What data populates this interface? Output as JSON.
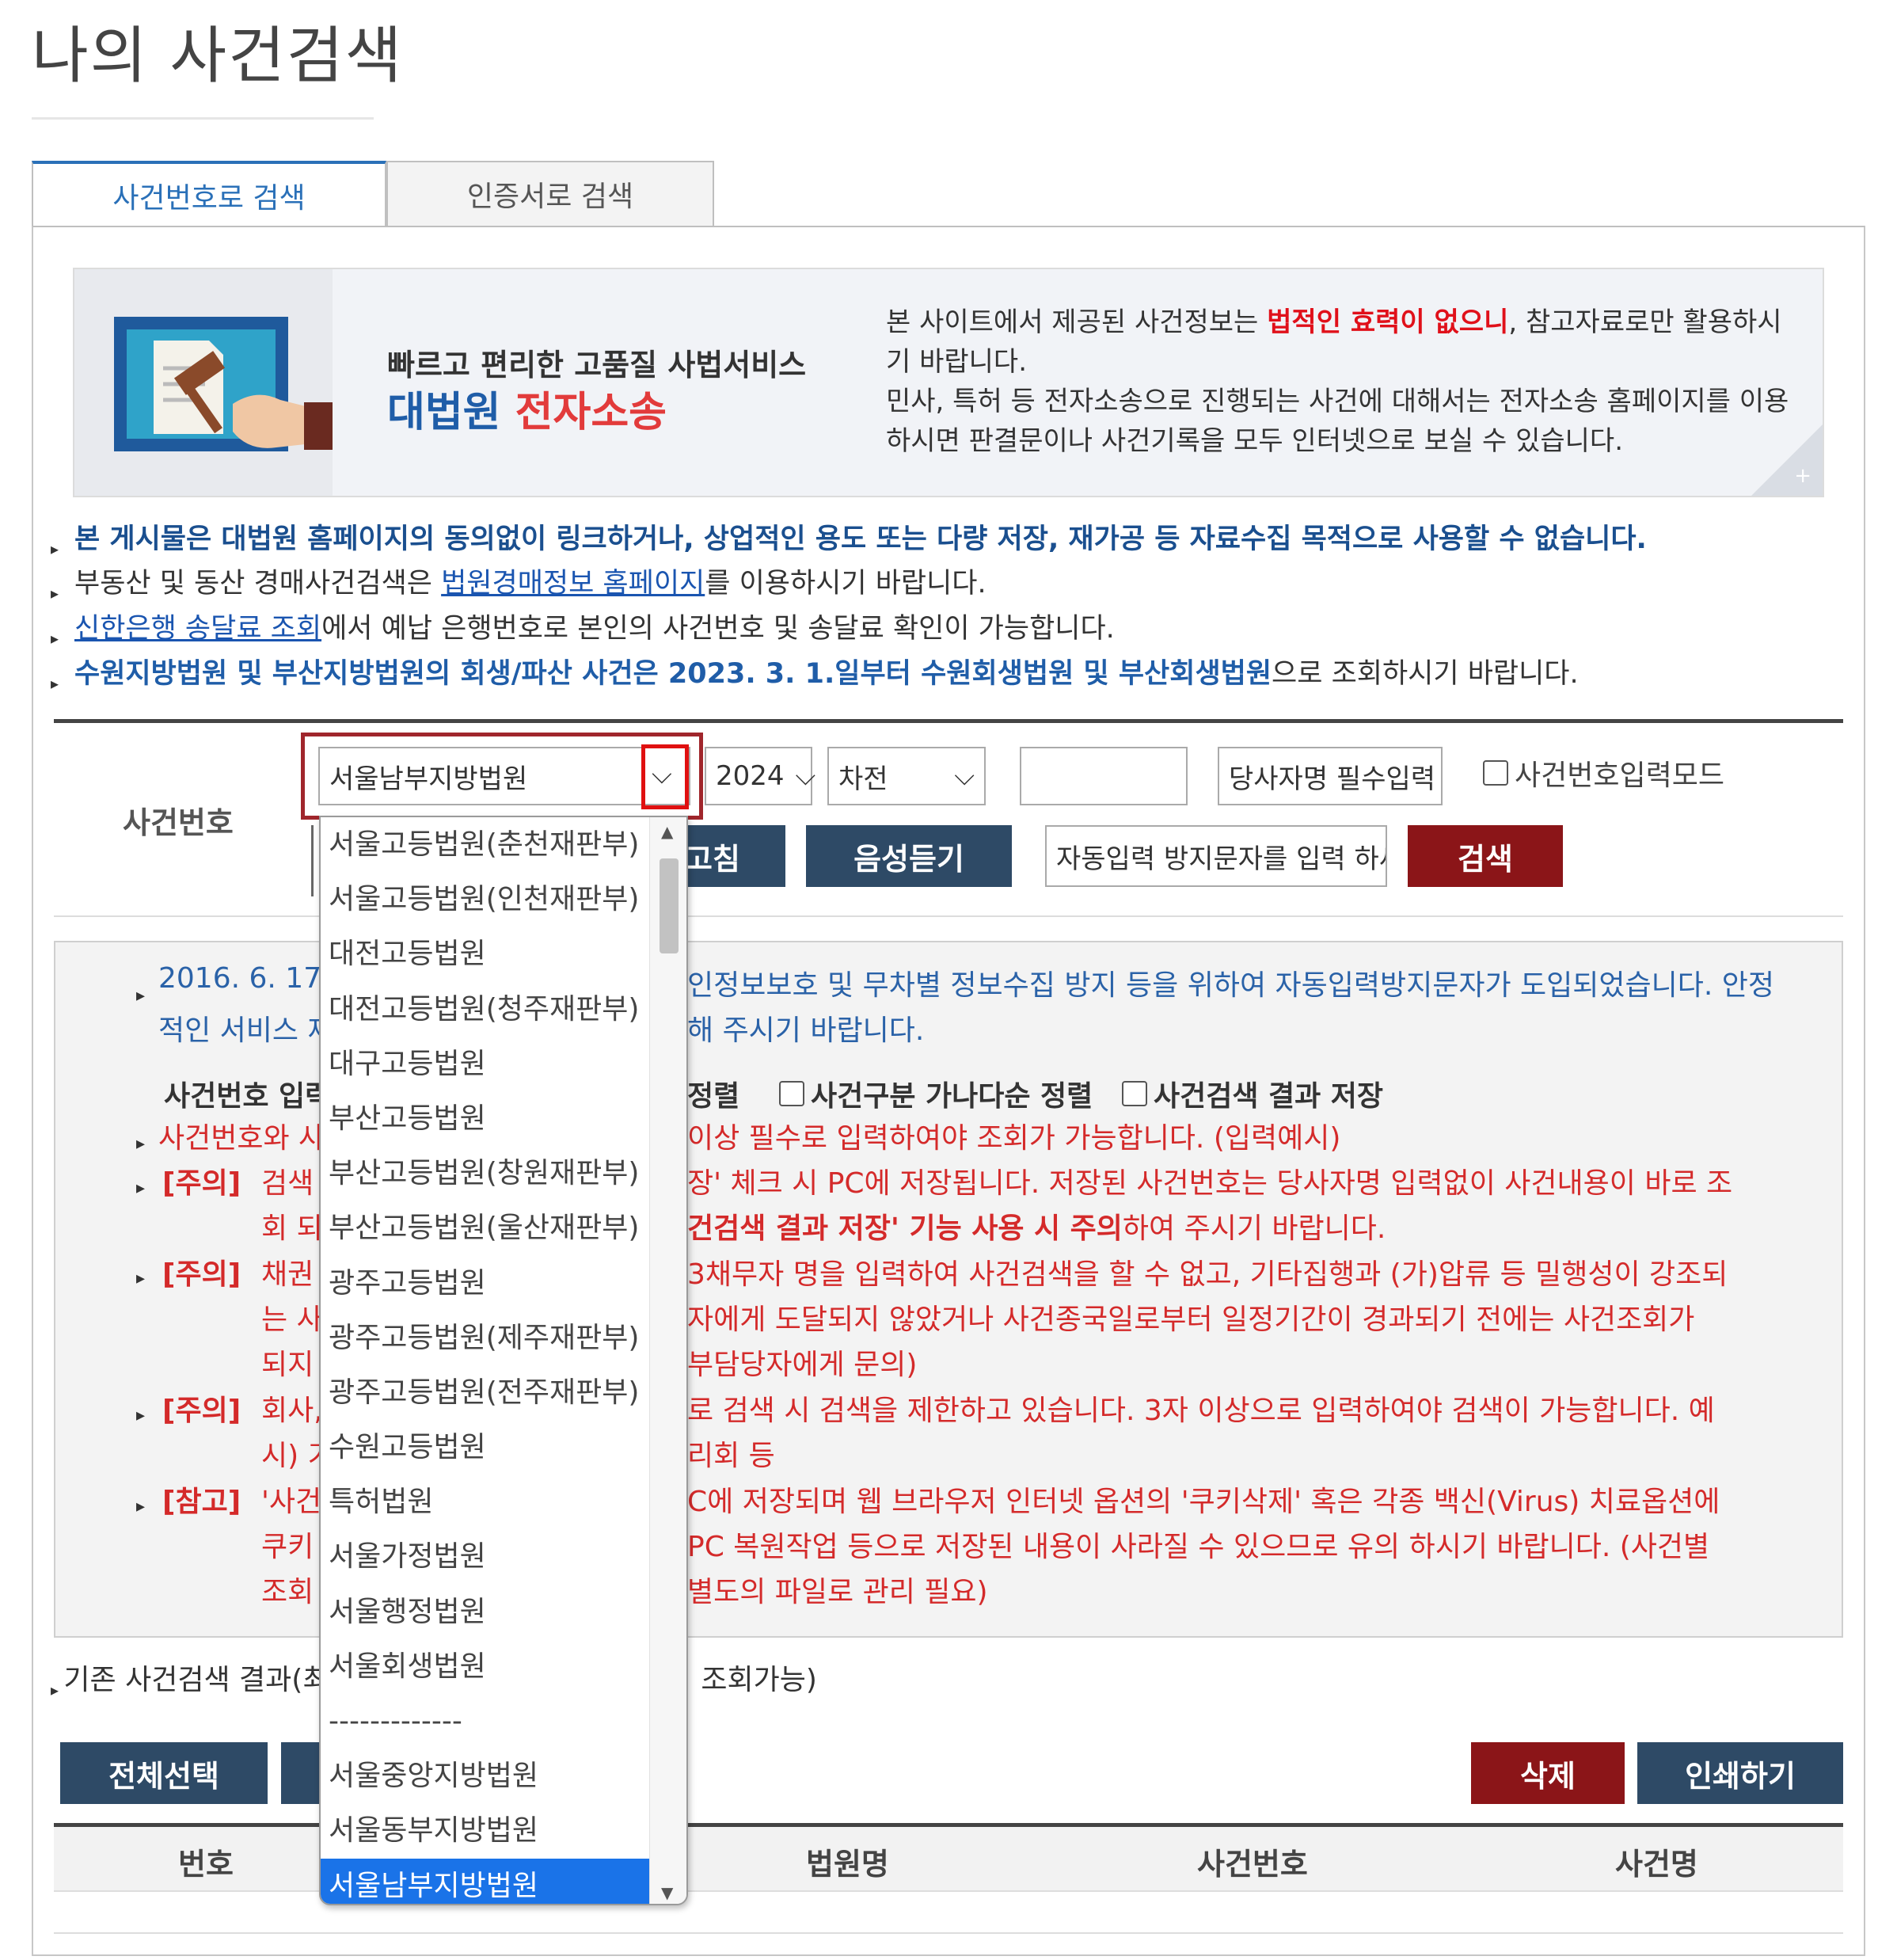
{
  "page_title": "나의 사건검색",
  "tabs": {
    "by_case": "사건번호로 검색",
    "by_cert": "인증서로 검색"
  },
  "banner": {
    "tagline": "빠르고 편리한 고품질 사법서비스",
    "brand_blue": "대법원",
    "brand_red": "전자소송",
    "notice_p1": "본 사이트에서 제공된 사건정보는 ",
    "notice_red": "법적인 효력이 없으니",
    "notice_p2": ", 참고자료로만 활용하시기 바랍니다.",
    "notice_p3": "민사, 특허 등 전자소송으로 진행되는 사건에 대해서는 전자소송 홈페이지를 이용하시면 판결문이나 사건기록을 모두 인터넷으로 보실 수 있습니다.",
    "plus": "+"
  },
  "bullets": {
    "b1": "본 게시물은 대법원 홈페이지의 동의없이 링크하거나, 상업적인 용도 또는 다량 저장, 재가공 등 자료수집 목적으로 사용할 수 없습니다.",
    "b2_pre": "부동산 및 동산 경매사건검색은 ",
    "b2_link": "법원경매정보 홈페이지",
    "b2_post": "를 이용하시기 바랍니다.",
    "b3_link": "신한은행 송달료 조회",
    "b3_post": "에서 예납 은행번호로 본인의 사건번호 및 송달료 확인이 가능합니다.",
    "b4_bold": "수원지방법원 및 부산지방법원의 회생/파산 사건은 2023. 3. 1.일부터 수원회생법원 및 부산회생법원",
    "b4_post": "으로 조회하시기 바랍니다."
  },
  "search": {
    "label": "사건번호",
    "court_selected": "서울남부지방법원",
    "year": "2024",
    "prefix": "차전",
    "party_placeholder": "당사자명 필수입력",
    "mode_checkbox": "사건번호입력모드",
    "refresh_btn": "고침",
    "audio_btn": "음성듣기",
    "captcha_placeholder": "자동입력 방지문자를 입력 하세요",
    "search_btn": "검색"
  },
  "notices": {
    "n1a": "2016. 6. 17.",
    "n1b": "인정보보호 및 무차별 정보수집 방지 등을 위하여 자동입력방지문자가 도입되었습니다. 안정",
    "n1c": "적인 서비스 제",
    "n1d": "해 주시기 바랍니다.",
    "n2a": "사건번호 입력",
    "n2b": "정렬",
    "n2c": "사건구분 가나다순 정렬",
    "n2d": "사건검색 결과 저장",
    "n3a": "사건번호와 사",
    "n3b": "이상 필수로 입력하여야 조회가 가능합니다. (입력예시)",
    "n4a": "[주의]",
    "n4b": "검색",
    "n4c": "장' 체크 시 PC에 저장됩니다. 저장된 사건번호는 당사자명 입력없이 사건내용이 바로 조",
    "n4d": "회 되",
    "n4e": "건검색 결과 저장' 기능 사용 시 주의",
    "n4f": "하여 주시기 바랍니다.",
    "n5a": "[주의]",
    "n5b": "채권",
    "n5c": "3채무자 명을 입력하여 사건검색을 할 수 없고, 기타집행과 (가)압류 등 밀행성이 강조되",
    "n5d": "는 사",
    "n5e": "자에게 도달되지 않았거나 사건종국일로부터 일정기간이 경과되기 전에는 사건조회가",
    "n5f": "되지",
    "n5g": "부담당자에게 문의)",
    "n6a": "[주의]",
    "n6b": "회사,",
    "n6c": "로 검색 시 검색을 제한하고 있습니다. 3자 이상으로 입력하여야 검색이 가능합니다. 예",
    "n6d": "시) 기",
    "n6e": "리회 등",
    "n7a": "[참고]",
    "n7b": "'사건",
    "n7c": "C에 저장되며 웹 브라우저 인터넷 옵션의 '쿠키삭제' 혹은 각종 백신(Virus) 치료옵션에",
    "n7d": "쿠키",
    "n7e": "PC 복원작업 등으로 저장된 내용이 사라질 수 있으므로 유의 하시기 바랍니다. (사건별",
    "n7f": "조회",
    "n7g": "별도의 파일로 관리 필요)"
  },
  "results": {
    "prev_a": "기존 사건검색 결과(최",
    "prev_b": "조회가능)",
    "select_all": "전체선택",
    "delete": "삭제",
    "print": "인쇄하기",
    "col_no": "번호",
    "col_court": "법원명",
    "col_case": "사건번호",
    "col_name": "사건명"
  },
  "dropdown_options": [
    "서울고등법원(춘천재판부)",
    "서울고등법원(인천재판부)",
    "대전고등법원",
    "대전고등법원(청주재판부)",
    "대구고등법원",
    "부산고등법원",
    "부산고등법원(창원재판부)",
    "부산고등법원(울산재판부)",
    "광주고등법원",
    "광주고등법원(제주재판부)",
    "광주고등법원(전주재판부)",
    "수원고등법원",
    "특허법원",
    "서울가정법원",
    "서울행정법원",
    "서울회생법원",
    "-------------",
    "서울중앙지방법원",
    "서울동부지방법원",
    "서울남부지방법원"
  ],
  "colors": {
    "accent_blue": "#2a70b8",
    "navy_button": "#2e4a66",
    "red_button": "#8b1518",
    "highlight": "#1a73e8"
  }
}
